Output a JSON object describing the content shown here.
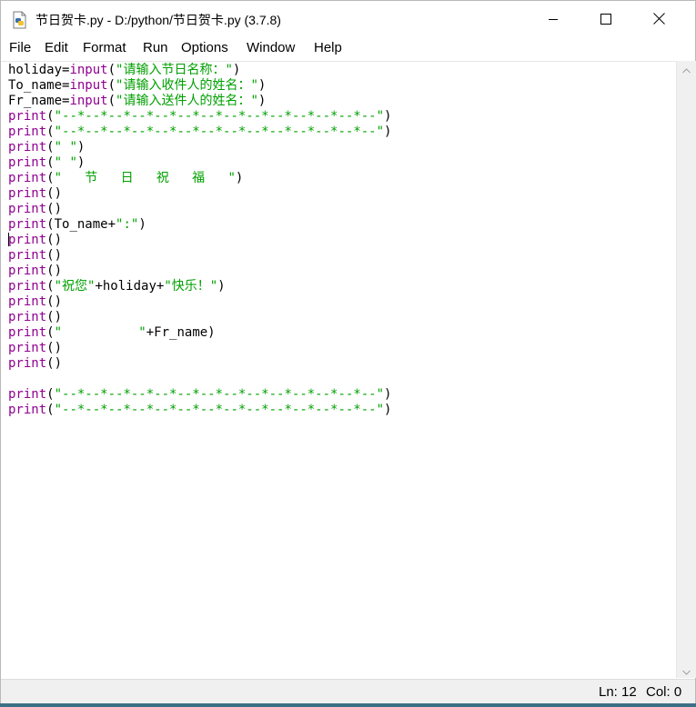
{
  "window": {
    "title": "节日贺卡.py - D:/python/节日贺卡.py (3.7.8)"
  },
  "menu": [
    "File",
    "Edit",
    "Format",
    "Run",
    "Options",
    "Window",
    "Help"
  ],
  "code_lines": [
    [
      {
        "t": "holiday=",
        "c": "plain"
      },
      {
        "t": "input",
        "c": "bi"
      },
      {
        "t": "(",
        "c": "plain"
      },
      {
        "t": "\"请输入节日名称：\"",
        "c": "str"
      },
      {
        "t": ")",
        "c": "plain"
      }
    ],
    [
      {
        "t": "To_name=",
        "c": "plain"
      },
      {
        "t": "input",
        "c": "bi"
      },
      {
        "t": "(",
        "c": "plain"
      },
      {
        "t": "\"请输入收件人的姓名：\"",
        "c": "str"
      },
      {
        "t": ")",
        "c": "plain"
      }
    ],
    [
      {
        "t": "Fr_name=",
        "c": "plain"
      },
      {
        "t": "input",
        "c": "bi"
      },
      {
        "t": "(",
        "c": "plain"
      },
      {
        "t": "\"请输入送件人的姓名：\"",
        "c": "str"
      },
      {
        "t": ")",
        "c": "plain"
      }
    ],
    [
      {
        "t": "print",
        "c": "bi"
      },
      {
        "t": "(",
        "c": "plain"
      },
      {
        "t": "\"--*--*--*--*--*--*--*--*--*--*--*--*--*--\"",
        "c": "str"
      },
      {
        "t": ")",
        "c": "plain"
      }
    ],
    [
      {
        "t": "print",
        "c": "bi"
      },
      {
        "t": "(",
        "c": "plain"
      },
      {
        "t": "\"--*--*--*--*--*--*--*--*--*--*--*--*--*--\"",
        "c": "str"
      },
      {
        "t": ")",
        "c": "plain"
      }
    ],
    [
      {
        "t": "print",
        "c": "bi"
      },
      {
        "t": "(",
        "c": "plain"
      },
      {
        "t": "\" \"",
        "c": "str"
      },
      {
        "t": ")",
        "c": "plain"
      }
    ],
    [
      {
        "t": "print",
        "c": "bi"
      },
      {
        "t": "(",
        "c": "plain"
      },
      {
        "t": "\" \"",
        "c": "str"
      },
      {
        "t": ")",
        "c": "plain"
      }
    ],
    [
      {
        "t": "print",
        "c": "bi"
      },
      {
        "t": "(",
        "c": "plain"
      },
      {
        "t": "\"   节   日   祝   福   \"",
        "c": "str"
      },
      {
        "t": ")",
        "c": "plain"
      }
    ],
    [
      {
        "t": "print",
        "c": "bi"
      },
      {
        "t": "()",
        "c": "plain"
      }
    ],
    [
      {
        "t": "print",
        "c": "bi"
      },
      {
        "t": "()",
        "c": "plain"
      }
    ],
    [
      {
        "t": "print",
        "c": "bi"
      },
      {
        "t": "(To_name+",
        "c": "plain"
      },
      {
        "t": "\":\"",
        "c": "str"
      },
      {
        "t": ")",
        "c": "plain"
      }
    ],
    [
      {
        "t": "print",
        "c": "bi"
      },
      {
        "t": "()",
        "c": "plain"
      }
    ],
    [
      {
        "t": "print",
        "c": "bi"
      },
      {
        "t": "()",
        "c": "plain"
      }
    ],
    [
      {
        "t": "print",
        "c": "bi"
      },
      {
        "t": "()",
        "c": "plain"
      }
    ],
    [
      {
        "t": "print",
        "c": "bi"
      },
      {
        "t": "(",
        "c": "plain"
      },
      {
        "t": "\"祝您\"",
        "c": "str"
      },
      {
        "t": "+holiday+",
        "c": "plain"
      },
      {
        "t": "\"快乐！\"",
        "c": "str"
      },
      {
        "t": ")",
        "c": "plain"
      }
    ],
    [
      {
        "t": "print",
        "c": "bi"
      },
      {
        "t": "()",
        "c": "plain"
      }
    ],
    [
      {
        "t": "print",
        "c": "bi"
      },
      {
        "t": "()",
        "c": "plain"
      }
    ],
    [
      {
        "t": "print",
        "c": "bi"
      },
      {
        "t": "(",
        "c": "plain"
      },
      {
        "t": "\"          \"",
        "c": "str"
      },
      {
        "t": "+Fr_name)",
        "c": "plain"
      }
    ],
    [
      {
        "t": "print",
        "c": "bi"
      },
      {
        "t": "()",
        "c": "plain"
      }
    ],
    [
      {
        "t": "print",
        "c": "bi"
      },
      {
        "t": "()",
        "c": "plain"
      }
    ],
    [],
    [
      {
        "t": "print",
        "c": "bi"
      },
      {
        "t": "(",
        "c": "plain"
      },
      {
        "t": "\"--*--*--*--*--*--*--*--*--*--*--*--*--*--\"",
        "c": "str"
      },
      {
        "t": ")",
        "c": "plain"
      }
    ],
    [
      {
        "t": "print",
        "c": "bi"
      },
      {
        "t": "(",
        "c": "plain"
      },
      {
        "t": "\"--*--*--*--*--*--*--*--*--*--*--*--*--*--\"",
        "c": "str"
      },
      {
        "t": ")",
        "c": "plain"
      }
    ]
  ],
  "status": {
    "ln": "Ln: 12",
    "col": "Col: 0"
  },
  "icons": {
    "app": "python-file-icon",
    "minimize": "minimize-icon",
    "maximize": "maximize-icon",
    "close": "close-icon"
  }
}
